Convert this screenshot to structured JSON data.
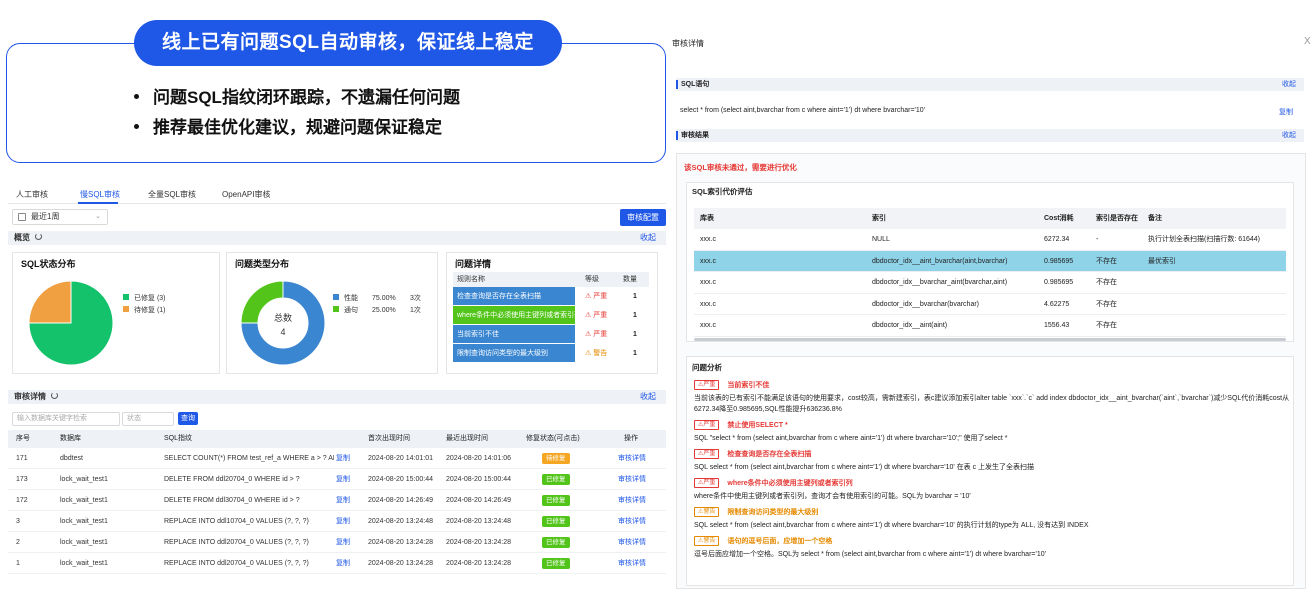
{
  "banner": {
    "title": "线上已有问题SQL自动审核，保证线上稳定",
    "bullets": [
      "问题SQL指纹闭环跟踪，不遗漏任何问题",
      "推荐最佳优化建议，规避问题保证稳定"
    ]
  },
  "left": {
    "tabs": [
      "人工审核",
      "慢SQL审核",
      "全量SQL审核",
      "OpenAPI审核"
    ],
    "active_tab": 1,
    "date_range": "最近1周",
    "config_button": "审核配置",
    "overview": {
      "title": "概览",
      "collapse": "收起"
    },
    "status_chart": {
      "title": "SQL状态分布",
      "legend": [
        {
          "label": "已修复",
          "count": "(3)",
          "color": "#13c26b"
        },
        {
          "label": "待修复",
          "count": "(1)",
          "color": "#f0a040"
        }
      ]
    },
    "type_chart": {
      "title": "问题类型分布",
      "center_label": "总数",
      "center_value": "4",
      "legend": [
        {
          "label": "性能",
          "pct": "75.00%",
          "count": "3次",
          "color": "#3a86d0"
        },
        {
          "label": "通句",
          "pct": "25.00%",
          "count": "1次",
          "color": "#52c41a"
        }
      ]
    },
    "issue_detail": {
      "title": "问题详情",
      "headers": [
        "规则名称",
        "等级",
        "数量"
      ],
      "rows": [
        {
          "name": "检查查询是否存在全表扫描",
          "level": "严重",
          "count": "1",
          "kind": "blue",
          "lvl": "red"
        },
        {
          "name": "where条件中必须使用主键列或者索引列",
          "level": "严重",
          "count": "1",
          "kind": "green",
          "lvl": "red"
        },
        {
          "name": "当前索引不佳",
          "level": "严重",
          "count": "1",
          "kind": "blue",
          "lvl": "red"
        },
        {
          "name": "限制查询访问类型的最大级别",
          "level": "警告",
          "count": "1",
          "kind": "blue",
          "lvl": "orange"
        }
      ]
    },
    "audit_detail": {
      "title": "审核详情",
      "collapse": "收起"
    },
    "filter": {
      "placeholder": "输入数据库关键字检索",
      "status_placeholder": "状态",
      "query_button": "查询"
    },
    "table": {
      "headers": [
        "序号",
        "数据库",
        "SQL指纹",
        "首次出现时间",
        "最近出现时间",
        "修复状态(可点击)",
        "操作"
      ],
      "copy_label": "复制",
      "rows": [
        {
          "id": "171",
          "db": "dbdtest",
          "sql": "SELECT COUNT(*) FROM test_ref_a WHERE a > ? AND ...",
          "first": "2024-08-20 14:01:01",
          "last": "2024-08-20 14:01:06",
          "status": "待修复",
          "status_kind": "orange",
          "op": "审核详情"
        },
        {
          "id": "173",
          "db": "lock_wait_test1",
          "sql": "DELETE FROM ddl20704_0 WHERE id > ?",
          "first": "2024-08-20 15:00:44",
          "last": "2024-08-20 15:00:44",
          "status": "已修复",
          "status_kind": "green",
          "op": "审核详情"
        },
        {
          "id": "172",
          "db": "lock_wait_test1",
          "sql": "DELETE FROM ddl30704_0 WHERE id > ?",
          "first": "2024-08-20 14:26:49",
          "last": "2024-08-20 14:26:49",
          "status": "已修复",
          "status_kind": "green",
          "op": "审核详情"
        },
        {
          "id": "3",
          "db": "lock_wait_test1",
          "sql": "REPLACE INTO ddl10704_0 VALUES (?, ?, ?)",
          "first": "2024-08-20 13:24:48",
          "last": "2024-08-20 13:24:48",
          "status": "已修复",
          "status_kind": "green",
          "op": "审核详情"
        },
        {
          "id": "2",
          "db": "lock_wait_test1",
          "sql": "REPLACE INTO ddl20704_0 VALUES (?, ?, ?)",
          "first": "2024-08-20 13:24:28",
          "last": "2024-08-20 13:24:28",
          "status": "已修复",
          "status_kind": "green",
          "op": "审核详情"
        },
        {
          "id": "1",
          "db": "lock_wait_test1",
          "sql": "REPLACE INTO ddl20704_0 VALUES (?, ?, ?)",
          "first": "2024-08-20 13:24:28",
          "last": "2024-08-20 13:24:28",
          "status": "已修复",
          "status_kind": "green",
          "op": "审核详情"
        }
      ]
    }
  },
  "right": {
    "title": "审核详情",
    "close": "X",
    "sql_section": {
      "title": "SQL语句",
      "collapse": "收起"
    },
    "sql_text": "select * from (select aint,bvarchar from c where aint='1') dt where bvarchar='10'",
    "copy": "复制",
    "result_section": {
      "title": "审核结果",
      "collapse": "收起"
    },
    "fail_text": "该SQL审核未通过，需要进行优化",
    "index_eval": {
      "title": "SQL索引代价评估",
      "headers": [
        "库表",
        "索引",
        "Cost消耗",
        "索引是否存在",
        "备注"
      ],
      "rows": [
        {
          "table": "xxx.c",
          "index": "NULL",
          "cost": "6272.34",
          "exists": "-",
          "note": "执行计划全表扫描(扫描行数: 61644)",
          "hl": false
        },
        {
          "table": "xxx.c",
          "index": "dbdoctor_idx__aint_bvarchar(aint,bvarchar)",
          "cost": "0.985695",
          "exists": "不存在",
          "note": "最优索引",
          "hl": true
        },
        {
          "table": "xxx.c",
          "index": "dbdoctor_idx__bvarchar_aint(bvarchar,aint)",
          "cost": "0.985695",
          "exists": "不存在",
          "note": "",
          "hl": false
        },
        {
          "table": "xxx.c",
          "index": "dbdoctor_idx__bvarchar(bvarchar)",
          "cost": "4.62275",
          "exists": "不存在",
          "note": "",
          "hl": false
        },
        {
          "table": "xxx.c",
          "index": "dbdoctor_idx__aint(aint)",
          "cost": "1556.43",
          "exists": "不存在",
          "note": "",
          "hl": false
        }
      ]
    },
    "analysis": {
      "title": "问题分析",
      "items": [
        {
          "tag": "严重",
          "warn": false,
          "title": "当前索引不佳",
          "body": "当前该表的已有索引不能满足该语句的使用要求，cost较高，需新建索引，表c建议添加索引alter table `xxx`.`c` add index dbdoctor_idx__aint_bvarchar(`aint`,`bvarchar`)减少SQL代价消耗cost从6272.34降至0.985695,SQL性能提升636236.8%"
        },
        {
          "tag": "严重",
          "warn": false,
          "title": "禁止使用SELECT *",
          "body": "SQL \"select * from (select aint,bvarchar from c where aint='1') dt where bvarchar='10';\" 使用了select *"
        },
        {
          "tag": "严重",
          "warn": false,
          "title": "检查查询是否存在全表扫描",
          "body": "SQL select * from (select aint,bvarchar from c where aint='1') dt where bvarchar='10' 在表 c 上发生了全表扫描"
        },
        {
          "tag": "严重",
          "warn": false,
          "title": "where条件中必须使用主键列或者索引列",
          "body": "where条件中使用主键列或者索引列，查询才会有使用索引的可能。SQL为 bvarchar = '10'"
        },
        {
          "tag": "警告",
          "warn": true,
          "title": "限制查询访问类型的最大级别",
          "body": "SQL select * from (select aint,bvarchar from c where aint='1') dt where bvarchar='10' 的执行计划的type为 ALL, 没有达到 INDEX"
        },
        {
          "tag": "警告",
          "warn": true,
          "title": "语句的逗号后面，应增加一个空格",
          "body": "逗号后面应增加一个空格。SQL为 select * from (select aint,bvarchar from c where aint='1') dt where bvarchar='10'"
        }
      ]
    }
  }
}
